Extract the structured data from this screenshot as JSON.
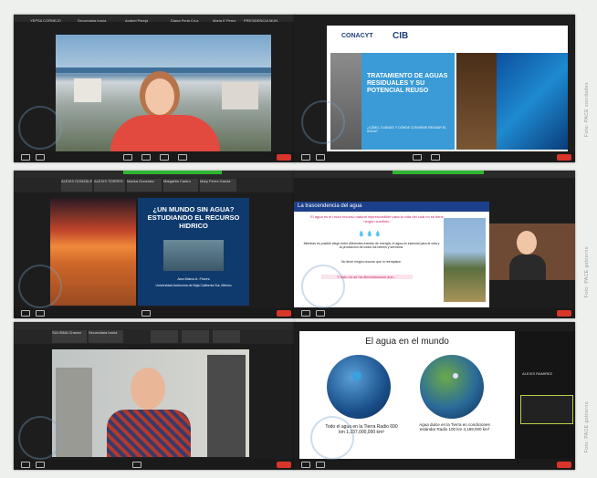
{
  "panel1": {
    "participants": [
      "YEPSA CORNEJO",
      "Secundaria Ironia",
      "Anabel Pareja",
      "Diana Perla Cruz",
      "Maria E Perez",
      "PRESIDENCIA MUN"
    ]
  },
  "panel2": {
    "logos": [
      "CONACYT",
      "CIB"
    ],
    "title": "TRATAMIENTO DE AGUAS RESIDUALES Y SU POTENCIAL REUSO",
    "subtitle": "¿CÓMO, CUÁNDO Y DÓNDE CONVIENE REUSAR EL AGUA?"
  },
  "panel3": {
    "participants": [
      "ALEXIS GONZALEZ",
      "ALEXIS TORRES",
      "Marisa Gonzalez",
      "Margarita Castro",
      "Mary Perez Garcia"
    ],
    "title": "¿UN MUNDO SIN AGUA? ESTUDIANDO EL RECURSO HIDRICO",
    "author": "Ana María A. Flores",
    "institution": "Universidad Autónoma de Baja California Sur, México"
  },
  "panel4": {
    "header": "La trascendencia del agua",
    "para1": "El agua es el único recurso natural imprescindible para la vida del cual no se tiene ningún sustituto.",
    "para2": "Mientras es posible elegir entre diferentes fuentes de energía, el agua es esencial para la vida y la producción de todos los bienes y servicios.",
    "para3": "No tiene ningún recurso que lo reemplace.",
    "highlight": "Y esto no se ha dimensionado aún…"
  },
  "panel5": {
    "participants": [
      "SULISMA Chavez",
      "Secundaria Ironia",
      "",
      "",
      ""
    ]
  },
  "panel6": {
    "title": "El agua en el mundo",
    "caption_left": "Todo el agua en la Tierra Radio 690 km 1,337,000,000 km³",
    "caption_right": "Agua dulce en la Tierra en condiciones estándar Radio 100 km 4,189,000 km³",
    "sidebar_name": "ALEXIS RAMIREZ"
  },
  "side_credits": [
    "Foto: PACE socidades",
    "Foto: PACE gobierno",
    "Foto: PACE gobierno"
  ]
}
